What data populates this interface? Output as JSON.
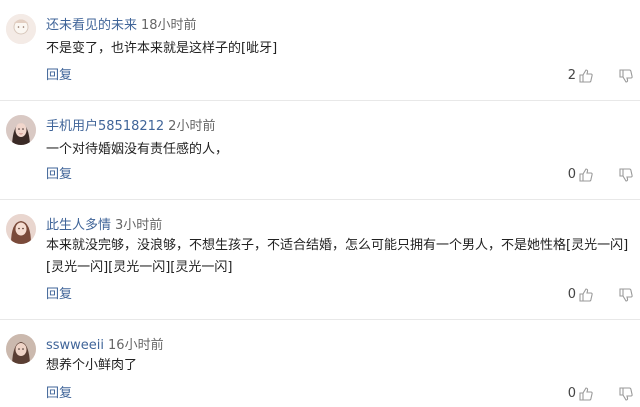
{
  "comments": [
    {
      "username": "还未看见的未来",
      "time": "18小时前",
      "text": "不是变了，也许本来就是这样子的[呲牙]",
      "reply_label": "回复",
      "likes": "2",
      "like_icon": "thumbs-up-icon",
      "dislike_icon": "thumbs-down-icon"
    },
    {
      "username": "手机用户58518212",
      "time": "2小时前",
      "text": "一个对待婚姻没有责任感的人，",
      "reply_label": "回复",
      "likes": "0",
      "like_icon": "thumbs-up-icon",
      "dislike_icon": "thumbs-down-icon"
    },
    {
      "username": "此生人多情",
      "time": "3小时前",
      "text": "本来就没完够，没浪够，不想生孩子，不适合结婚，怎么可能只拥有一个男人，不是她性格[灵光一闪][灵光一闪][灵光一闪][灵光一闪]",
      "reply_label": "回复",
      "likes": "0",
      "like_icon": "thumbs-up-icon",
      "dislike_icon": "thumbs-down-icon"
    },
    {
      "username": "sswweeii",
      "time": "16小时前",
      "text": "想养个小鲜肉了",
      "reply_label": "回复",
      "likes": "0",
      "like_icon": "thumbs-up-icon",
      "dislike_icon": "thumbs-down-icon"
    }
  ],
  "colors": {
    "username": "#406599",
    "reply": "#406599",
    "meta": "#666666",
    "divider": "#e8e8e8",
    "icon": "#9a9a9a"
  }
}
